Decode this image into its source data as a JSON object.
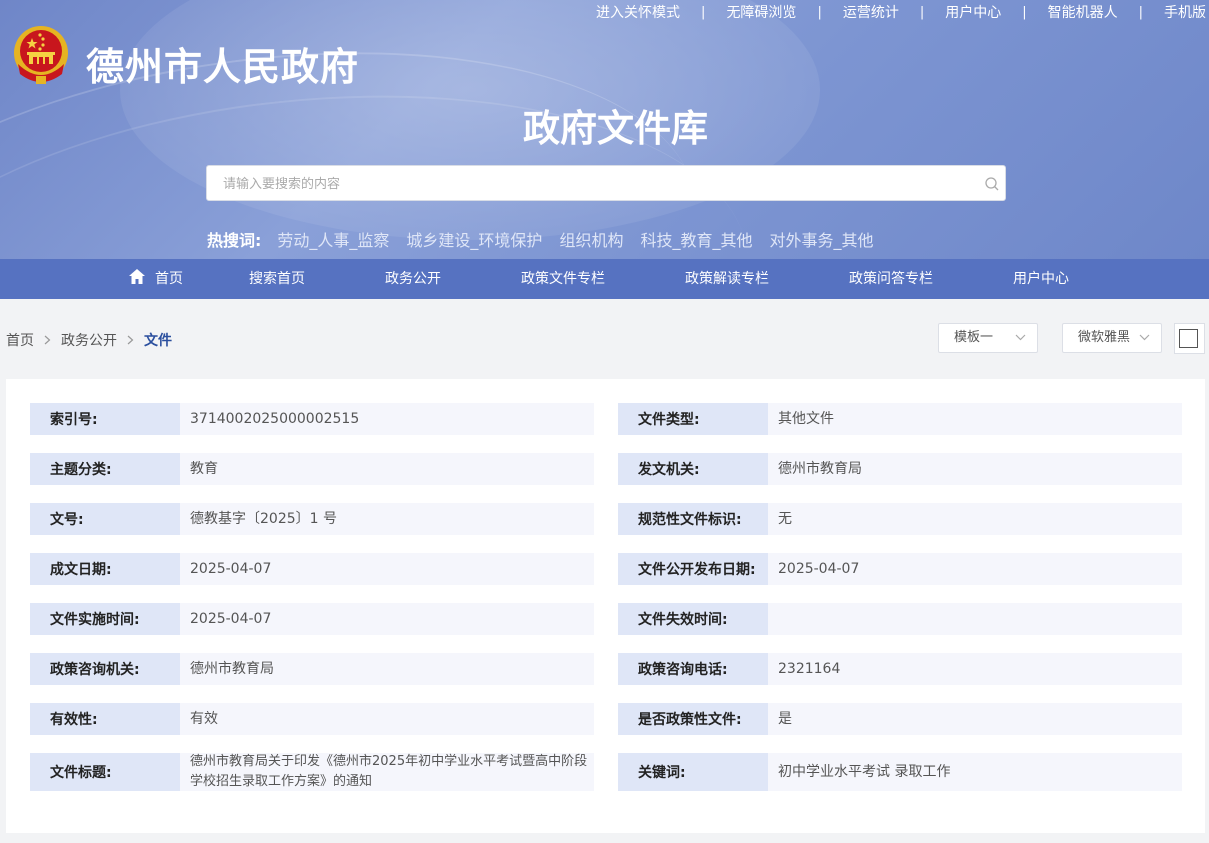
{
  "top_links": [
    "进入关怀模式",
    "无障碍浏览",
    "运营统计",
    "用户中心",
    "智能机器人",
    "手机版"
  ],
  "site_title": "德州市人民政府",
  "library_title": "政府文件库",
  "search": {
    "placeholder": "请输入要搜索的内容"
  },
  "hot_search": {
    "label": "热搜词:",
    "keywords": [
      "劳动_人事_监察",
      "城乡建设_环境保护",
      "组织机构",
      "科技_教育_其他",
      "对外事务_其他"
    ]
  },
  "nav": [
    "首页",
    "搜索首页",
    "政务公开",
    "政策文件专栏",
    "政策解读专栏",
    "政策问答专栏",
    "用户中心"
  ],
  "breadcrumb": {
    "items": [
      "首页",
      "政务公开"
    ],
    "current": "文件"
  },
  "template_select": "模板一",
  "font_select": "微软雅黑",
  "fields": [
    {
      "key": "索引号:",
      "value": "3714002025000002515"
    },
    {
      "key": "文件类型:",
      "value": "其他文件"
    },
    {
      "key": "主题分类:",
      "value": "教育"
    },
    {
      "key": "发文机关:",
      "value": "德州市教育局"
    },
    {
      "key": "文号:",
      "value": "德教基字〔2025〕1 号"
    },
    {
      "key": "规范性文件标识:",
      "value": "无"
    },
    {
      "key": "成文日期:",
      "value": "2025-04-07"
    },
    {
      "key": "文件公开发布日期:",
      "value": "2025-04-07"
    },
    {
      "key": "文件实施时间:",
      "value": "2025-04-07"
    },
    {
      "key": "文件失效时间:",
      "value": ""
    },
    {
      "key": "政策咨询机关:",
      "value": "德州市教育局"
    },
    {
      "key": "政策咨询电话:",
      "value": "2321164"
    },
    {
      "key": "有效性:",
      "value": "有效"
    },
    {
      "key": "是否政策性文件:",
      "value": "是"
    },
    {
      "key": "文件标题:",
      "value": "德州市教育局关于印发《德州市2025年初中学业水平考试暨高中阶段学校招生录取工作方案》的通知"
    },
    {
      "key": "关键词:",
      "value": "初中学业水平考试 录取工作"
    }
  ],
  "colors": {
    "banner": "#7d95d2",
    "nav": "#5672c1",
    "label_bg": "#dfe6f7",
    "value_bg": "#f5f6fc"
  }
}
